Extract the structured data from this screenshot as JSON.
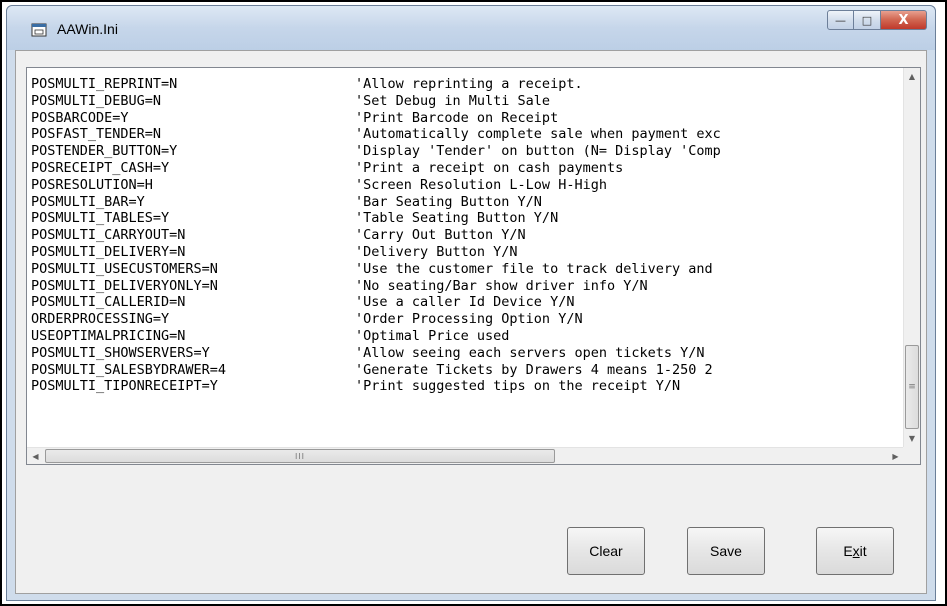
{
  "window": {
    "title": "AAWin.Ini",
    "minimize_glyph": "—",
    "maximize_glyph": "□",
    "close_glyph": "X"
  },
  "ini_lines": [
    {
      "key": "POSMULTI_REPRINT=N",
      "comment": "'Allow reprinting a receipt."
    },
    {
      "key": "POSMULTI_DEBUG=N",
      "comment": "'Set Debug in Multi Sale"
    },
    {
      "key": "POSBARCODE=Y",
      "comment": "'Print Barcode on Receipt"
    },
    {
      "key": "POSFAST_TENDER=N",
      "comment": "'Automatically complete sale when payment exc"
    },
    {
      "key": "POSTENDER_BUTTON=Y",
      "comment": "'Display 'Tender' on button (N= Display 'Comp"
    },
    {
      "key": "POSRECEIPT_CASH=Y",
      "comment": "'Print a receipt on cash payments"
    },
    {
      "key": "POSRESOLUTION=H",
      "comment": "'Screen Resolution L-Low H-High"
    },
    {
      "key": "POSMULTI_BAR=Y",
      "comment": "'Bar Seating Button Y/N"
    },
    {
      "key": "POSMULTI_TABLES=Y",
      "comment": "'Table Seating Button Y/N"
    },
    {
      "key": "POSMULTI_CARRYOUT=N",
      "comment": "'Carry Out Button Y/N"
    },
    {
      "key": "POSMULTI_DELIVERY=N",
      "comment": "'Delivery Button Y/N"
    },
    {
      "key": "POSMULTI_USECUSTOMERS=N",
      "comment": "'Use the customer file to track delivery and"
    },
    {
      "key": "POSMULTI_DELIVERYONLY=N",
      "comment": "'No seating/Bar show driver info Y/N"
    },
    {
      "key": "POSMULTI_CALLERID=N",
      "comment": "'Use a caller Id Device Y/N"
    },
    {
      "key": "ORDERPROCESSING=Y",
      "comment": "'Order Processing Option Y/N"
    },
    {
      "key": "USEOPTIMALPRICING=N",
      "comment": "'Optimal Price used"
    },
    {
      "key": "POSMULTI_SHOWSERVERS=Y",
      "comment": "'Allow seeing each servers open tickets Y/N"
    },
    {
      "key": "POSMULTI_SALESBYDRAWER=4",
      "comment": "'Generate Tickets by Drawers 4 means 1-250 2"
    },
    {
      "key": "POSMULTI_TIPONRECEIPT=Y",
      "comment": "'Print suggested tips on the receipt Y/N"
    }
  ],
  "scroll": {
    "up_glyph": "▲",
    "down_glyph": "▼",
    "left_glyph": "◀",
    "right_glyph": "▶",
    "vthumb_grip": "≡",
    "hthumb_grip": "III"
  },
  "buttons": {
    "clear": "Clear",
    "save": "Save",
    "exit_prefix": "E",
    "exit_mnemonic": "x",
    "exit_suffix": "it"
  }
}
